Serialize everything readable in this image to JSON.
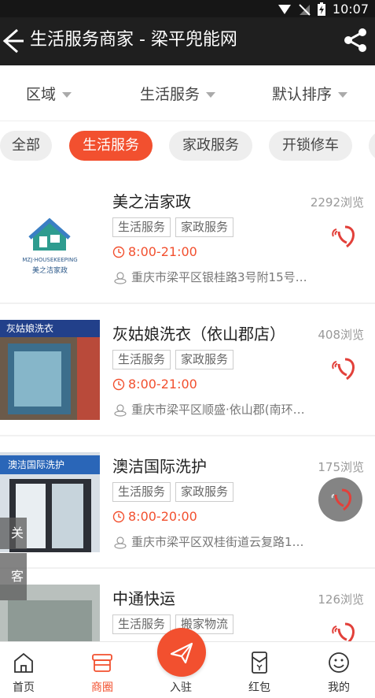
{
  "status_bar": {
    "time": "10:07"
  },
  "app_bar": {
    "title": "生活服务商家 - 梁平兜能网"
  },
  "filters": [
    {
      "label": "区域"
    },
    {
      "label": "生活服务"
    },
    {
      "label": "默认排序"
    }
  ],
  "chips": [
    {
      "label": "全部",
      "active": false
    },
    {
      "label": "生活服务",
      "active": true
    },
    {
      "label": "家政服务",
      "active": false
    },
    {
      "label": "开锁修车",
      "active": false
    }
  ],
  "listings": [
    {
      "name": "美之洁家政",
      "views": "2292浏览",
      "tags": [
        "生活服务",
        "家政服务"
      ],
      "hours": "8:00-21:00",
      "address": "重庆市梁平区银桂路3号附15号…",
      "logo": {
        "line1": "MZJ·HOUSEKEEPING",
        "line2": "美之洁家政"
      }
    },
    {
      "name": "灰姑娘洗衣（依山郡店）",
      "views": "408浏览",
      "tags": [
        "生活服务",
        "家政服务"
      ],
      "hours": "8:00-21:00",
      "address": "重庆市梁平区顺盛·依山郡(南环…",
      "photo_sign": "灰姑娘洗衣"
    },
    {
      "name": "澳洁国际洗护",
      "views": "175浏览",
      "tags": [
        "生活服务",
        "家政服务"
      ],
      "hours": "8:00-20:00",
      "address": "重庆市梁平区双桂街道云复路1…",
      "photo_sign": "澳洁国际洗护"
    },
    {
      "name": "中通快运",
      "views": "126浏览",
      "tags": [
        "生活服务",
        "搬家物流"
      ],
      "hours": "",
      "address": ""
    }
  ],
  "floating": {
    "follow": "关注",
    "service": "客服"
  },
  "tabbar": [
    {
      "label": "首页",
      "active": false,
      "icon": "home-icon"
    },
    {
      "label": "商圈",
      "active": true,
      "icon": "store-icon"
    },
    {
      "label": "入驻",
      "active": false,
      "icon": "send-icon"
    },
    {
      "label": "红包",
      "active": false,
      "icon": "red-packet-icon"
    },
    {
      "label": "我的",
      "active": false,
      "icon": "smile-icon"
    }
  ],
  "colors": {
    "accent": "#f2502f",
    "appbar": "#1f1f1f"
  }
}
